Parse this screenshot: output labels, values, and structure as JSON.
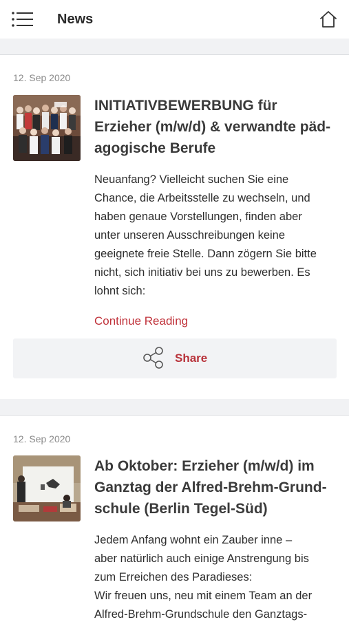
{
  "header": {
    "title": "News",
    "menu_icon": "hamburger-menu-icon",
    "home_icon": "home-icon"
  },
  "articles": [
    {
      "date": "12. Sep 2020",
      "title_lines": [
        "INITIATIVBEWERBUNG für",
        "Erzieher (m/w/d) & verwandte päd-",
        "agogische Berufe"
      ],
      "excerpt_lines": [
        "Neuanfang? Vielleicht suchen Sie eine",
        "Chance, die Arbeitsstelle zu wechseln, und",
        "haben genaue Vorstellungen, finden aber",
        "unter unseren Ausschreibungen keine",
        "geeignete freie Stelle. Dann zögern Sie bitte",
        "nicht, sich initiativ bei uns zu bewerben. Es",
        "lohnt sich:"
      ],
      "continue_label": "Continue Reading",
      "share_label": "Share",
      "share_icon": "share-icon"
    },
    {
      "date": "12. Sep 2020",
      "title_lines": [
        "Ab Oktober: Erzieher (m/w/d) im",
        "Ganztag der Alfred-Brehm-Grund-",
        "schule (Berlin Tegel-Süd)"
      ],
      "excerpt_lines": [
        "Jedem Anfang wohnt ein Zauber inne –",
        "aber natürlich auch einige Anstrengung bis",
        "zum Erreichen des Paradieses:",
        "Wir freuen uns, neu mit einem Team an der",
        "Alfred-Brehm-Grundschule den Ganztags-"
      ]
    }
  ],
  "colors": {
    "accent": "#c0323a",
    "separator": "#f1f2f4",
    "share_bar": "#f2f3f5",
    "date_text": "#8a8a8a"
  }
}
